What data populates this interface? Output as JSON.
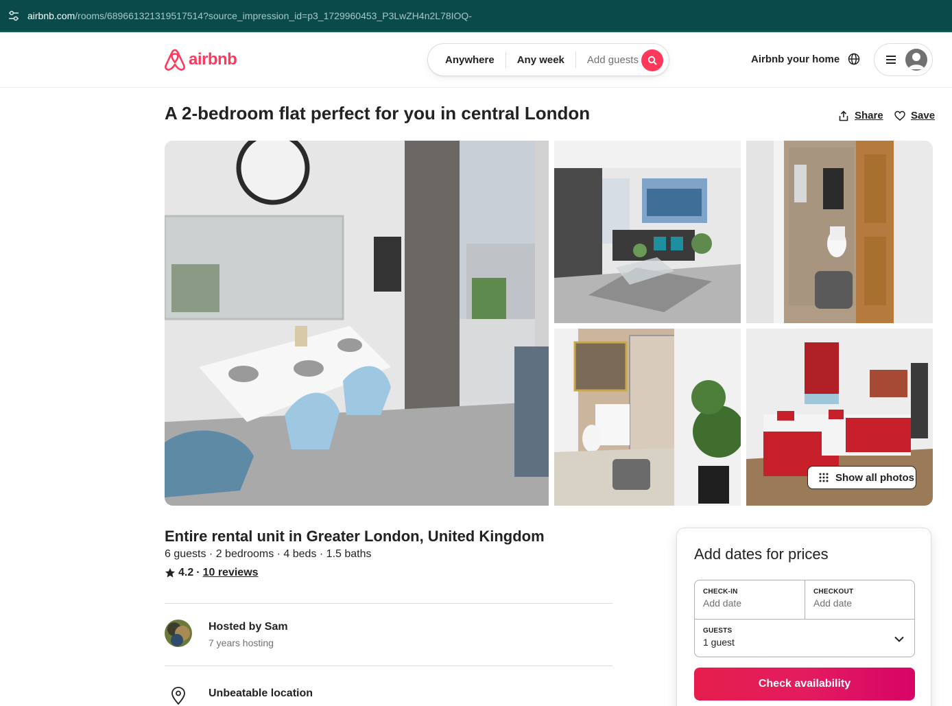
{
  "browser": {
    "url_host": "airbnb.com",
    "url_path": "/rooms/689661321319517514?source_impression_id=p3_1729960453_P3LwZH4n2L78IOQ-"
  },
  "header": {
    "logo_text": "airbnb",
    "search": {
      "location": "Anywhere",
      "dates": "Any week",
      "guests_placeholder": "Add guests"
    },
    "host_link": "Airbnb your home"
  },
  "listing": {
    "title": "A 2-bedroom flat perfect for you in central London",
    "share_label": "Share",
    "save_label": "Save",
    "show_all_photos": "Show all photos",
    "type": "Entire rental unit in Greater London, United Kingdom",
    "meta": "6 guests · 2 bedrooms · 4 beds · 1.5 baths",
    "rating": "4.2",
    "rating_sep": "·",
    "reviews": "10 reviews",
    "host": {
      "name": "Hosted by Sam",
      "years": "7 years hosting"
    },
    "highlight": "Unbeatable location"
  },
  "booking": {
    "title": "Add dates for prices",
    "checkin_label": "CHECK-IN",
    "checkin_value": "Add date",
    "checkout_label": "CHECKOUT",
    "checkout_value": "Add date",
    "guests_label": "GUESTS",
    "guests_value": "1 guest",
    "cta": "Check availability"
  },
  "colors": {
    "brand": "#ff385c",
    "cta_gradient_start": "#e61e4d",
    "cta_gradient_end": "#d70466",
    "browser_bar": "#0b4a4a"
  },
  "icons": [
    "tune-icon",
    "airbnb-logo-icon",
    "search-icon",
    "globe-icon",
    "hamburger-menu-icon",
    "user-avatar-icon",
    "share-icon",
    "heart-icon",
    "grid-dots-icon",
    "star-icon",
    "map-pin-icon",
    "chevron-down-icon"
  ]
}
